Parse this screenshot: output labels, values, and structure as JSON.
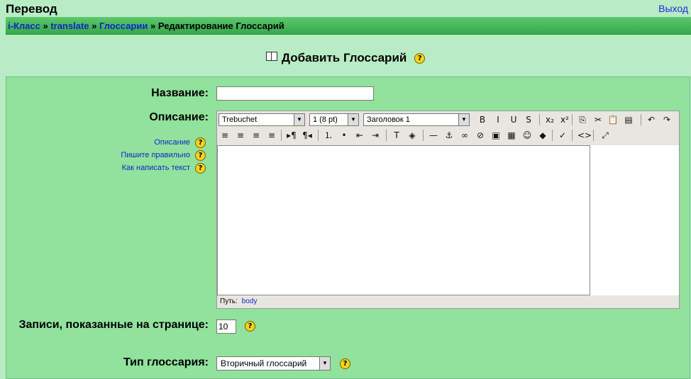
{
  "header": {
    "site_title": "Перевод",
    "logout": "Выход"
  },
  "breadcrumb": {
    "items": [
      "i-Класс",
      "translate",
      "Глоссарии"
    ],
    "current": "Редактирование Глоссарий",
    "sep": "»"
  },
  "page": {
    "heading": "Добавить Глоссарий"
  },
  "form": {
    "name_label": "Название:",
    "name_value": "",
    "description_label": "Описание:",
    "help_links": [
      "Описание",
      "Пишите правильно",
      "Как написать текст"
    ],
    "entries_label": "Записи, показанные на странице:",
    "entries_value": "10",
    "type_label": "Тип глоссария:",
    "type_value": "Вторичный глоссарий"
  },
  "editor": {
    "font": "Trebuchet",
    "size": "1 (8 pt)",
    "format": "Заголовок 1",
    "path_label": "Путь:",
    "path_value": "body",
    "row1": [
      {
        "name": "bold-icon",
        "glyph": "B"
      },
      {
        "name": "italic-icon",
        "glyph": "I"
      },
      {
        "name": "underline-icon",
        "glyph": "U"
      },
      {
        "name": "strikethrough-icon",
        "glyph": "S"
      },
      {
        "name": "subscript-icon",
        "glyph": "x₂"
      },
      {
        "name": "superscript-icon",
        "glyph": "x²"
      },
      {
        "name": "copy-icon",
        "glyph": "⎘"
      },
      {
        "name": "cut-icon",
        "glyph": "✂"
      },
      {
        "name": "paste-icon",
        "glyph": "📋"
      },
      {
        "name": "paste-word-icon",
        "glyph": "▤"
      },
      {
        "name": "undo-icon",
        "glyph": "↶"
      },
      {
        "name": "redo-icon",
        "glyph": "↷"
      }
    ],
    "row2": [
      {
        "name": "align-left-icon",
        "glyph": "≡"
      },
      {
        "name": "align-center-icon",
        "glyph": "≡"
      },
      {
        "name": "align-right-icon",
        "glyph": "≡"
      },
      {
        "name": "justify-icon",
        "glyph": "≡"
      },
      {
        "name": "ltr-icon",
        "glyph": "▸¶"
      },
      {
        "name": "rtl-icon",
        "glyph": "¶◂"
      },
      {
        "name": "ordered-list-icon",
        "glyph": "⒈"
      },
      {
        "name": "unordered-list-icon",
        "glyph": "•"
      },
      {
        "name": "outdent-icon",
        "glyph": "⇤"
      },
      {
        "name": "indent-icon",
        "glyph": "⇥"
      },
      {
        "name": "text-color-icon",
        "glyph": "T"
      },
      {
        "name": "bg-color-icon",
        "glyph": "◈"
      },
      {
        "name": "hr-icon",
        "glyph": "—"
      },
      {
        "name": "anchor-icon",
        "glyph": "⚓"
      },
      {
        "name": "link-icon",
        "glyph": "∞"
      },
      {
        "name": "unlink-icon",
        "glyph": "⊘"
      },
      {
        "name": "image-icon",
        "glyph": "▣"
      },
      {
        "name": "table-icon",
        "glyph": "▦"
      },
      {
        "name": "smiley-icon",
        "glyph": "☺"
      },
      {
        "name": "special-char-icon",
        "glyph": "◆"
      },
      {
        "name": "spellcheck-icon",
        "glyph": "✓"
      },
      {
        "name": "html-source-icon",
        "glyph": "<>"
      },
      {
        "name": "fullscreen-icon",
        "glyph": "⤢"
      }
    ]
  }
}
